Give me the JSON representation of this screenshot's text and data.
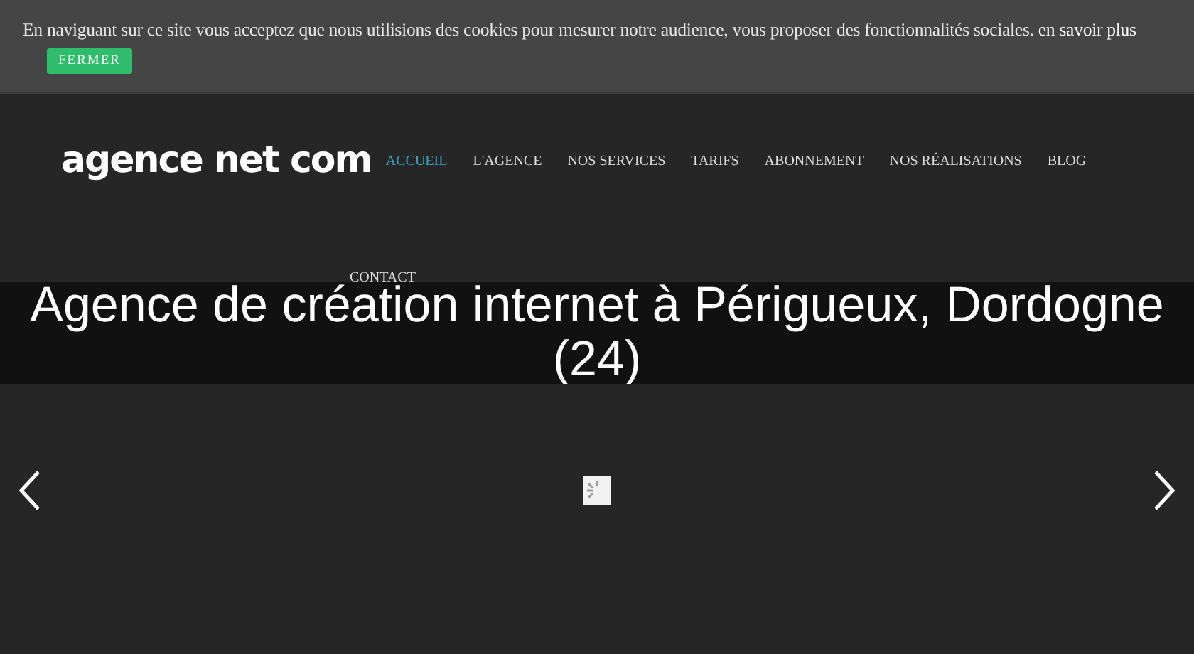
{
  "cookie_bar": {
    "message": "En naviguant sur ce site vous acceptez que nous utilisions des cookies pour mesurer notre audience, vous proposer des fonctionnalités sociales.",
    "link": "en savoir plus",
    "button": "FERMER"
  },
  "header": {
    "logo": "agence net com",
    "nav": [
      {
        "label": "ACCUEIL",
        "selected": true
      },
      {
        "label": "L'AGENCE",
        "selected": false
      },
      {
        "label": "NOS SERVICES",
        "selected": false
      },
      {
        "label": "TARIFS",
        "selected": false
      },
      {
        "label": "ABONNEMENT",
        "selected": false
      },
      {
        "label": "NOS RÉALISATIONS",
        "selected": false
      },
      {
        "label": "BLOG",
        "selected": false
      },
      {
        "label": "CONTACT",
        "selected": false
      }
    ]
  },
  "hero": {
    "title": "Agence de création internet à Périgueux, Dordogne (24)"
  }
}
